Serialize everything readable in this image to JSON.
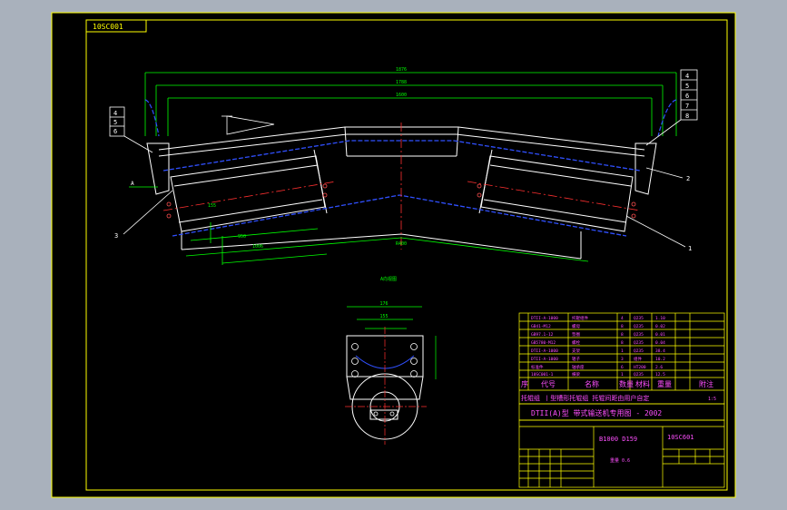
{
  "drawing_number": "10SC001",
  "colors": {
    "outer_bg": "#a9b1bc",
    "canvas": "#000000",
    "frame": "#ffff00",
    "conveyor": "#ffffff",
    "belt_dash": "#3050ff",
    "centerline": "#ff3030",
    "dimension": "#00ff00",
    "table_text": "#ff50ff",
    "leader": "#ffffff"
  },
  "callouts": {
    "left_stack": [
      "4",
      "5",
      "6"
    ],
    "right_stack": [
      "4",
      "5",
      "6",
      "7",
      "8"
    ],
    "left_single": "3",
    "right_upper": "2",
    "right_lower": "1",
    "a_mark": "A"
  },
  "dimensions": {
    "overall": "1876",
    "top_2": "1788",
    "top_3": "1600",
    "roller_a": "950",
    "roller_b": "1006",
    "radius": "R400",
    "view_label": "A向视图",
    "section_w": "176",
    "section_w2": "155"
  },
  "parts_rows": [
    [
      "DTII-A-1000",
      "托辊组件",
      "4",
      "Q235",
      "1.10"
    ],
    [
      "GB41-M12",
      "螺母",
      "8",
      "Q235",
      "0.02"
    ],
    [
      "GB97.1-12",
      "垫圈",
      "8",
      "Q235",
      "0.01"
    ],
    [
      "GB5780-M12",
      "螺栓",
      "8",
      "Q235",
      "0.04"
    ],
    [
      "DTII-A-1000",
      "支架",
      "1",
      "Q235",
      "38.4"
    ],
    [
      "DTII-A-1000",
      "辊子",
      "3",
      "组件",
      "10.2"
    ],
    [
      "标准件",
      "轴承座",
      "6",
      "HT200",
      "2.6"
    ],
    [
      "10SC001-1",
      "横梁",
      "1",
      "Q235",
      "12.5"
    ]
  ],
  "header_cells": [
    "序",
    "代号",
    "名称",
    "数量",
    "材料",
    "重量",
    "附注"
  ],
  "title_caption": "托辊组 丨型槽形托辊组 托辊间距由用户自定",
  "scale_note": "1:5",
  "series_title": "DTII(A)型 带式输送机专用图 - 2002",
  "spec": "B1000 D159",
  "drawing_code": "10SC601",
  "bottom_note": "重量 0.6"
}
